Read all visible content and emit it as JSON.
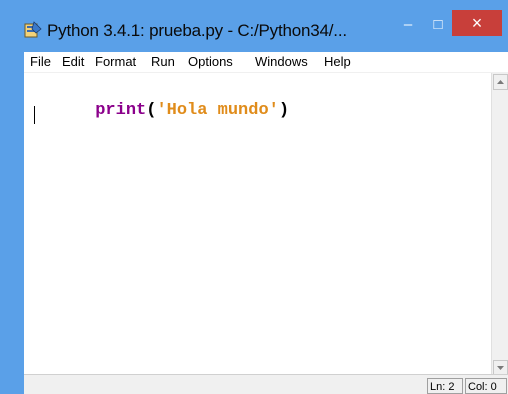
{
  "window": {
    "title": "Python 3.4.1: prueba.py - C:/Python34/...",
    "controls": {
      "minimize": "–",
      "maximize": "□",
      "close": "×"
    }
  },
  "menu": {
    "items": [
      {
        "label": "File"
      },
      {
        "label": "Edit"
      },
      {
        "label": "Format"
      },
      {
        "label": "Run"
      },
      {
        "label": "Options"
      },
      {
        "label": "Windows"
      },
      {
        "label": "Help"
      }
    ]
  },
  "editor": {
    "code": {
      "keyword": "print",
      "open": "(",
      "string": "'Hola mundo'",
      "close": ")"
    }
  },
  "status": {
    "ln": "Ln: 2",
    "col": "Col: 0"
  },
  "colors": {
    "titlebar": "#5aa0e8",
    "close_button": "#c83f3a",
    "keyword": "#8b008b",
    "string": "#e08c1b"
  },
  "icons": [
    "python-idle-icon",
    "scroll-up-icon",
    "scroll-down-icon",
    "close-icon"
  ]
}
